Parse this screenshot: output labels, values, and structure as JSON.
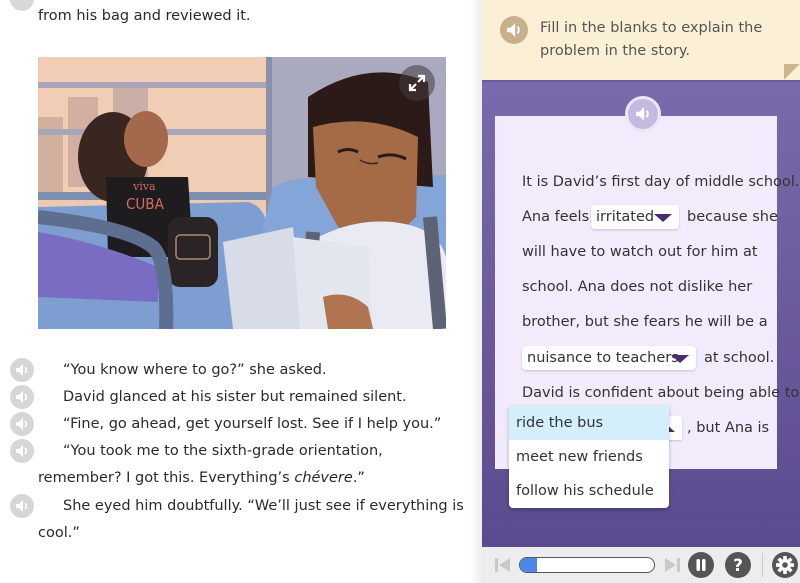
{
  "story": {
    "top_line": "from his bag and reviewed it.",
    "illustration": {
      "alt": "Ana and David riding the school bus",
      "shirt_text_1": "viva",
      "shirt_text_2": "CUBA",
      "expand_icon": "expand-arrows-icon"
    },
    "paragraphs": [
      {
        "text": "“You know where to go?” she asked."
      },
      {
        "text": "David glanced at his sister but remained silent."
      },
      {
        "text": "“Fine, go ahead, get yourself lost. See if I help you.”"
      },
      {
        "text": "“You took me to the sixth-grade orientation,",
        "cont_before": "remember? I got this. Everything’s ",
        "cont_italic": "chévere",
        "cont_after": ".”"
      },
      {
        "text": "She eyed him doubtfully. “We’ll just see if everything is",
        "cont": "cool.”"
      }
    ]
  },
  "prompt": {
    "text": "Fill in the blanks to explain the problem in the story.",
    "audio_icon": "speaker-icon"
  },
  "cloze": {
    "line1": "It is David’s first day of middle school.",
    "line2_before": "Ana feels",
    "line2_after": "because she",
    "line3": "will have to watch out for him at",
    "line4": "school. Ana does not dislike her",
    "line5": "brother, but she fears he will be a",
    "line6_after": "at school.",
    "line7": "David is confident about being able to",
    "line8_after": ", but Ana is",
    "dropdowns": [
      {
        "selected": "irritated",
        "open": false
      },
      {
        "selected": "nuisance to teachers",
        "open": false
      },
      {
        "selected": "ride the bus",
        "open": true,
        "options": [
          "ride the bus",
          "meet new friends",
          "follow his schedule"
        ],
        "highlighted": "ride the bus"
      }
    ]
  },
  "toolbar": {
    "progress_fraction": 0.13,
    "accent": "#4d86e6",
    "buttons": [
      "previous",
      "next",
      "pause",
      "help",
      "settings"
    ]
  },
  "colors": {
    "prompt_bg": "#fbf0d5",
    "panel_purple": "#6b5a9e",
    "card_bg": "#f1ebfb",
    "highlight": "#d4eefb"
  }
}
